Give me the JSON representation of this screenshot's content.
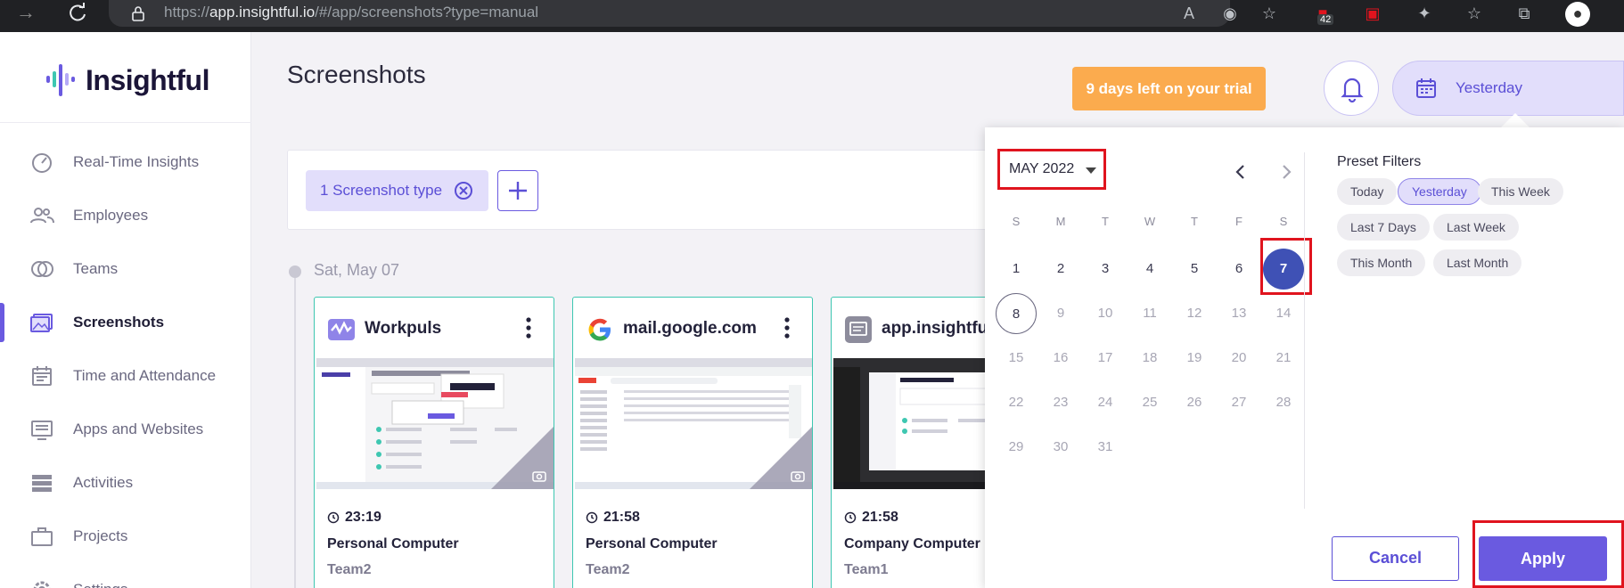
{
  "browser": {
    "url_prefix": "https://",
    "url_host": "app.insightful.io",
    "url_path": "/#/app/screenshots?type=manual",
    "extension_badge": "42"
  },
  "sidebar": {
    "brand": "Insightful",
    "items": [
      {
        "label": "Real-Time Insights",
        "icon": "realtime-icon"
      },
      {
        "label": "Employees",
        "icon": "employees-icon"
      },
      {
        "label": "Teams",
        "icon": "teams-icon"
      },
      {
        "label": "Screenshots",
        "icon": "screenshots-icon",
        "active": true
      },
      {
        "label": "Time and Attendance",
        "icon": "calendar-icon"
      },
      {
        "label": "Apps and Websites",
        "icon": "apps-icon"
      },
      {
        "label": "Activities",
        "icon": "activities-icon"
      },
      {
        "label": "Projects",
        "icon": "briefcase-icon"
      },
      {
        "label": "Settings",
        "icon": "gear-icon"
      }
    ]
  },
  "header": {
    "title": "Screenshots",
    "trial": "9 days left on your trial",
    "date_range": "Yesterday"
  },
  "filters": {
    "chip": "1 Screenshot type"
  },
  "timeline": {
    "date": "Sat, May 07",
    "cards": [
      {
        "app": "Workpuls",
        "time": "23:19",
        "computer": "Personal Computer",
        "team": "Team2"
      },
      {
        "app": "mail.google.com",
        "time": "21:58",
        "computer": "Personal Computer",
        "team": "Team2"
      },
      {
        "app": "app.insightful",
        "time": "21:58",
        "computer": "Company Computer",
        "team": "Team1"
      }
    ]
  },
  "picker": {
    "month": "MAY 2022",
    "weekdays": [
      "S",
      "M",
      "T",
      "W",
      "T",
      "F",
      "S"
    ],
    "weeks": [
      [
        "1",
        "2",
        "3",
        "4",
        "5",
        "6",
        "7"
      ],
      [
        "8",
        "9",
        "10",
        "11",
        "12",
        "13",
        "14"
      ],
      [
        "15",
        "16",
        "17",
        "18",
        "19",
        "20",
        "21"
      ],
      [
        "22",
        "23",
        "24",
        "25",
        "26",
        "27",
        "28"
      ],
      [
        "29",
        "30",
        "31"
      ]
    ],
    "selected_day": "7",
    "today_day": "8",
    "preset_title": "Preset Filters",
    "presets": [
      "Today",
      "Yesterday",
      "This Week",
      "Last 7 Days",
      "Last Week",
      "This Month",
      "Last Month"
    ],
    "active_preset": "Yesterday",
    "cancel": "Cancel",
    "apply": "Apply"
  },
  "colors": {
    "accent": "#6a5ae0",
    "trial": "#fbab4e",
    "selected_day": "#3f51b5",
    "highlight_frame": "#e0141e",
    "card_border": "#3ec7b1"
  }
}
